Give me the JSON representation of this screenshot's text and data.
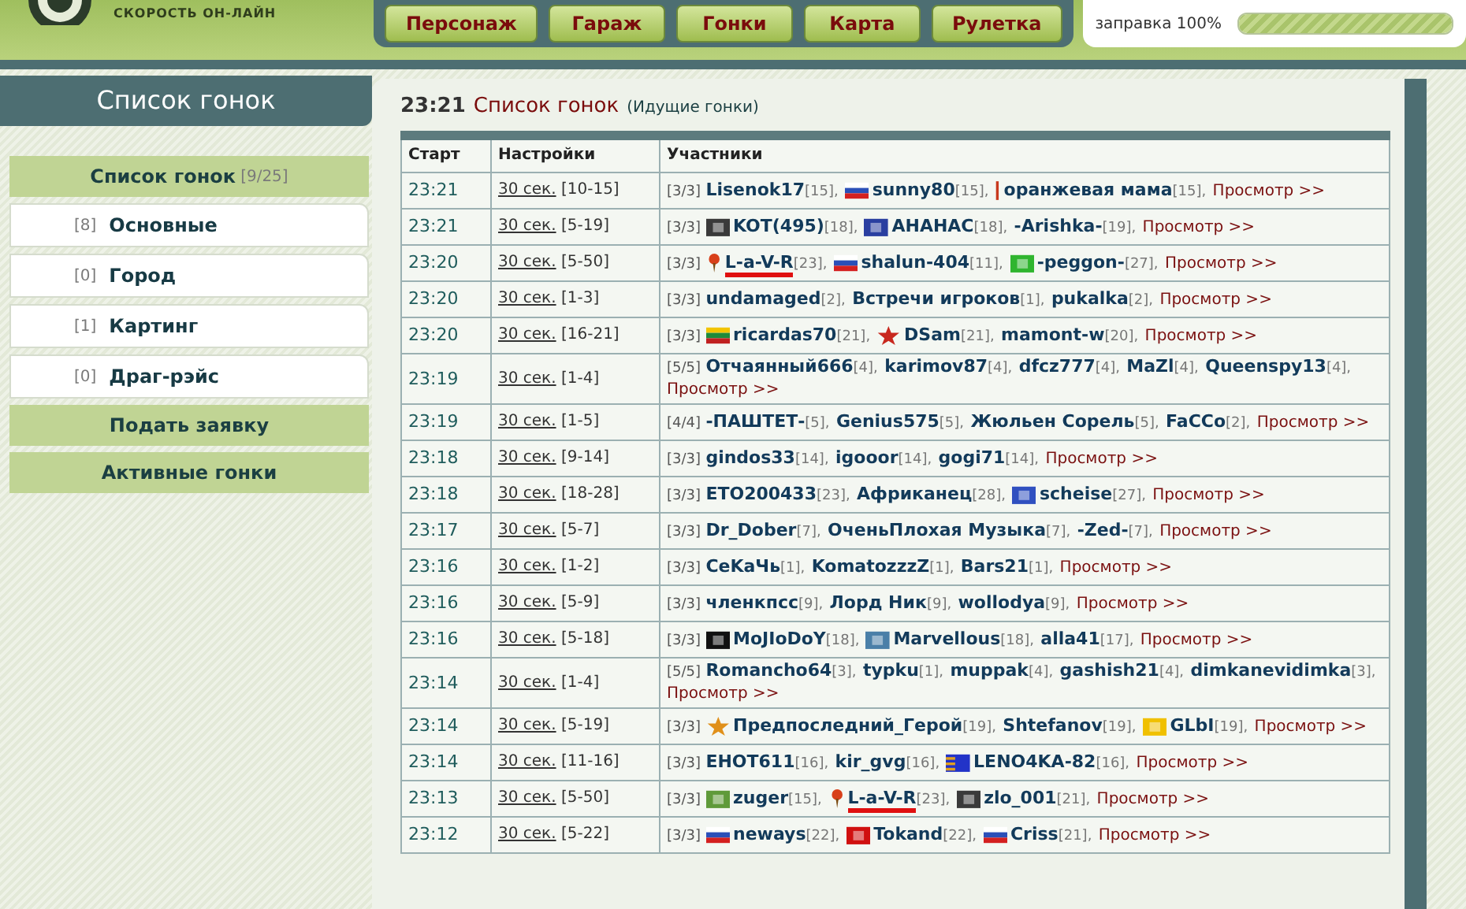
{
  "brand": {
    "tagline": "СКОРОСТЬ ОН-ЛАЙН"
  },
  "nav": [
    "Персонаж",
    "Гараж",
    "Гонки",
    "Карта",
    "Рулетка"
  ],
  "fuel": {
    "label": "заправка 100%",
    "level": 1.0
  },
  "sidebar": {
    "title": "Список гонок",
    "header": {
      "label": "Список гонок",
      "count": "[9/25]"
    },
    "categories": [
      {
        "count": "[8]",
        "label": "Основные"
      },
      {
        "count": "[0]",
        "label": "Город"
      },
      {
        "count": "[1]",
        "label": "Картинг"
      },
      {
        "count": "[0]",
        "label": "Драг-рэйс"
      }
    ],
    "buttons": [
      "Подать заявку",
      "Активные гонки"
    ]
  },
  "page": {
    "time": "23:21",
    "title": "Список гонок",
    "subtitle": "(Идущие гонки)"
  },
  "table": {
    "columns": [
      "Старт",
      "Настройки",
      "Участники"
    ],
    "separator": ",",
    "rows": [
      {
        "start": "23:21",
        "setting": "30 сек.",
        "range": "[10-15]",
        "filled": "[3/3]",
        "players": [
          {
            "name": "Lisenok17",
            "level": "[15]"
          },
          {
            "name": "sunny80",
            "level": "[15]",
            "icon": {
              "kind": "flag-ru"
            }
          },
          {
            "name": "оранжевая мама",
            "level": "[15]",
            "icon": {
              "kind": "sliver",
              "color": "#c83a1e"
            }
          }
        ],
        "view": "Просмотр >>"
      },
      {
        "start": "23:21",
        "setting": "30 сек.",
        "range": "[5-19]",
        "filled": "[3/3]",
        "players": [
          {
            "name": "KOT(495)",
            "level": "[18]",
            "icon": {
              "kind": "tile",
              "color": "#3a3a3a"
            }
          },
          {
            "name": "АНАНАС",
            "level": "[18]",
            "icon": {
              "kind": "tile",
              "color": "#2a3fa0"
            }
          },
          {
            "name": "-Arishka-",
            "level": "[19]"
          }
        ],
        "view": "Просмотр >>"
      },
      {
        "start": "23:20",
        "setting": "30 сек.",
        "range": "[5-50]",
        "filled": "[3/3]",
        "players": [
          {
            "name": "L-a-V-R",
            "level": "[23]",
            "icon": {
              "kind": "pin"
            },
            "marked": true
          },
          {
            "name": "shalun-404",
            "level": "[11]",
            "icon": {
              "kind": "flag-ru"
            }
          },
          {
            "name": "-peggon-",
            "level": "[27]",
            "icon": {
              "kind": "tile",
              "color": "#2fb52f"
            }
          }
        ],
        "view": "Просмотр >>"
      },
      {
        "start": "23:20",
        "setting": "30 сек.",
        "range": "[1-3]",
        "filled": "[3/3]",
        "players": [
          {
            "name": "undamaged",
            "level": "[2]"
          },
          {
            "name": "Встречи игроков",
            "level": "[1]"
          },
          {
            "name": "pukalka",
            "level": "[2]"
          }
        ],
        "view": "Просмотр >>"
      },
      {
        "start": "23:20",
        "setting": "30 сек.",
        "range": "[16-21]",
        "filled": "[3/3]",
        "players": [
          {
            "name": "ricardas70",
            "level": "[21]",
            "icon": {
              "kind": "flag-lt"
            }
          },
          {
            "name": "DSam",
            "level": "[21]",
            "icon": {
              "kind": "star",
              "color": "#c8281e"
            }
          },
          {
            "name": "mamont-w",
            "level": "[20]"
          }
        ],
        "view": "Просмотр >>"
      },
      {
        "start": "23:19",
        "setting": "30 сек.",
        "range": "[1-4]",
        "filled": "[5/5]",
        "players": [
          {
            "name": "Отчаянный666",
            "level": "[4]"
          },
          {
            "name": "karimov87",
            "level": "[4]"
          },
          {
            "name": "dfcz777",
            "level": "[4]"
          },
          {
            "name": "MaZl",
            "level": "[4]"
          },
          {
            "name": "Queenspy13",
            "level": "[4]"
          }
        ],
        "view": "Просмотр >>"
      },
      {
        "start": "23:19",
        "setting": "30 сек.",
        "range": "[1-5]",
        "filled": "[4/4]",
        "players": [
          {
            "name": "-ПАШТЕТ-",
            "level": "[5]"
          },
          {
            "name": "Genius575",
            "level": "[5]"
          },
          {
            "name": "Жюльен Сорель",
            "level": "[5]"
          },
          {
            "name": "FaCCo",
            "level": "[2]"
          }
        ],
        "view": "Просмотр >>"
      },
      {
        "start": "23:18",
        "setting": "30 сек.",
        "range": "[9-14]",
        "filled": "[3/3]",
        "players": [
          {
            "name": "gindos33",
            "level": "[14]"
          },
          {
            "name": "igooor",
            "level": "[14]"
          },
          {
            "name": "gogi71",
            "level": "[14]"
          }
        ],
        "view": "Просмотр >>"
      },
      {
        "start": "23:18",
        "setting": "30 сек.",
        "range": "[18-28]",
        "filled": "[3/3]",
        "players": [
          {
            "name": "ETO200433",
            "level": "[23]"
          },
          {
            "name": "Африканец",
            "level": "[28]"
          },
          {
            "name": "scheise",
            "level": "[27]",
            "icon": {
              "kind": "tile",
              "color": "#3050c0"
            }
          }
        ],
        "view": "Просмотр >>"
      },
      {
        "start": "23:17",
        "setting": "30 сек.",
        "range": "[5-7]",
        "filled": "[3/3]",
        "players": [
          {
            "name": "Dr_Dober",
            "level": "[7]"
          },
          {
            "name": "ОченьПлохая Музыка",
            "level": "[7]"
          },
          {
            "name": "-Zed-",
            "level": "[7]"
          }
        ],
        "view": "Просмотр >>"
      },
      {
        "start": "23:16",
        "setting": "30 сек.",
        "range": "[1-2]",
        "filled": "[3/3]",
        "players": [
          {
            "name": "CeKaЧь",
            "level": "[1]"
          },
          {
            "name": "KomatozzzZ",
            "level": "[1]"
          },
          {
            "name": "Bars21",
            "level": "[1]"
          }
        ],
        "view": "Просмотр >>"
      },
      {
        "start": "23:16",
        "setting": "30 сек.",
        "range": "[5-9]",
        "filled": "[3/3]",
        "players": [
          {
            "name": "членкпсс",
            "level": "[9]"
          },
          {
            "name": "Лорд Ник",
            "level": "[9]"
          },
          {
            "name": "wollodya",
            "level": "[9]"
          }
        ],
        "view": "Просмотр >>"
      },
      {
        "start": "23:16",
        "setting": "30 сек.",
        "range": "[5-18]",
        "filled": "[3/3]",
        "players": [
          {
            "name": "MoJIoDoY",
            "level": "[18]",
            "icon": {
              "kind": "tile",
              "color": "#111111"
            }
          },
          {
            "name": "Marvellous",
            "level": "[18]",
            "icon": {
              "kind": "tile",
              "color": "#4a7fa8"
            }
          },
          {
            "name": "alla41",
            "level": "[17]"
          }
        ],
        "view": "Просмотр >>"
      },
      {
        "start": "23:14",
        "setting": "30 сек.",
        "range": "[1-4]",
        "filled": "[5/5]",
        "players": [
          {
            "name": "Romancho64",
            "level": "[3]"
          },
          {
            "name": "typku",
            "level": "[1]"
          },
          {
            "name": "muppak",
            "level": "[4]"
          },
          {
            "name": "gashish21",
            "level": "[4]"
          },
          {
            "name": "dimkanevidimka",
            "level": "[3]"
          }
        ],
        "view": "Просмотр >>"
      },
      {
        "start": "23:14",
        "setting": "30 сек.",
        "range": "[5-19]",
        "filled": "[3/3]",
        "players": [
          {
            "name": "Предпоследний_Герой",
            "level": "[19]",
            "icon": {
              "kind": "star",
              "color": "#e0901a"
            }
          },
          {
            "name": "Shtefanov",
            "level": "[19]"
          },
          {
            "name": "GLbI",
            "level": "[19]",
            "icon": {
              "kind": "tile",
              "color": "#f0c000"
            }
          }
        ],
        "view": "Просмотр >>"
      },
      {
        "start": "23:14",
        "setting": "30 сек.",
        "range": "[11-16]",
        "filled": "[3/3]",
        "players": [
          {
            "name": "EHOT611",
            "level": "[16]"
          },
          {
            "name": "kir_gvg",
            "level": "[16]"
          },
          {
            "name": "LENO4KA-82",
            "level": "[16]",
            "icon": {
              "kind": "stripes"
            }
          }
        ],
        "view": "Просмотр >>"
      },
      {
        "start": "23:13",
        "setting": "30 сек.",
        "range": "[5-50]",
        "filled": "[3/3]",
        "players": [
          {
            "name": "zuger",
            "level": "[15]",
            "icon": {
              "kind": "tile",
              "color": "#5f9a3a"
            }
          },
          {
            "name": "L-a-V-R",
            "level": "[23]",
            "icon": {
              "kind": "pin"
            },
            "marked": true
          },
          {
            "name": "zlo_001",
            "level": "[21]",
            "icon": {
              "kind": "tile",
              "color": "#3a3a3a"
            }
          }
        ],
        "view": "Просмотр >>"
      },
      {
        "start": "23:12",
        "setting": "30 сек.",
        "range": "[5-22]",
        "filled": "[3/3]",
        "players": [
          {
            "name": "neways",
            "level": "[22]",
            "icon": {
              "kind": "flag-ru"
            }
          },
          {
            "name": "Tokand",
            "level": "[22]",
            "icon": {
              "kind": "tile",
              "color": "#d01010"
            }
          },
          {
            "name": "Criss",
            "level": "[21]",
            "icon": {
              "kind": "flag-ru"
            }
          }
        ],
        "view": "Просмотр >>"
      }
    ]
  }
}
